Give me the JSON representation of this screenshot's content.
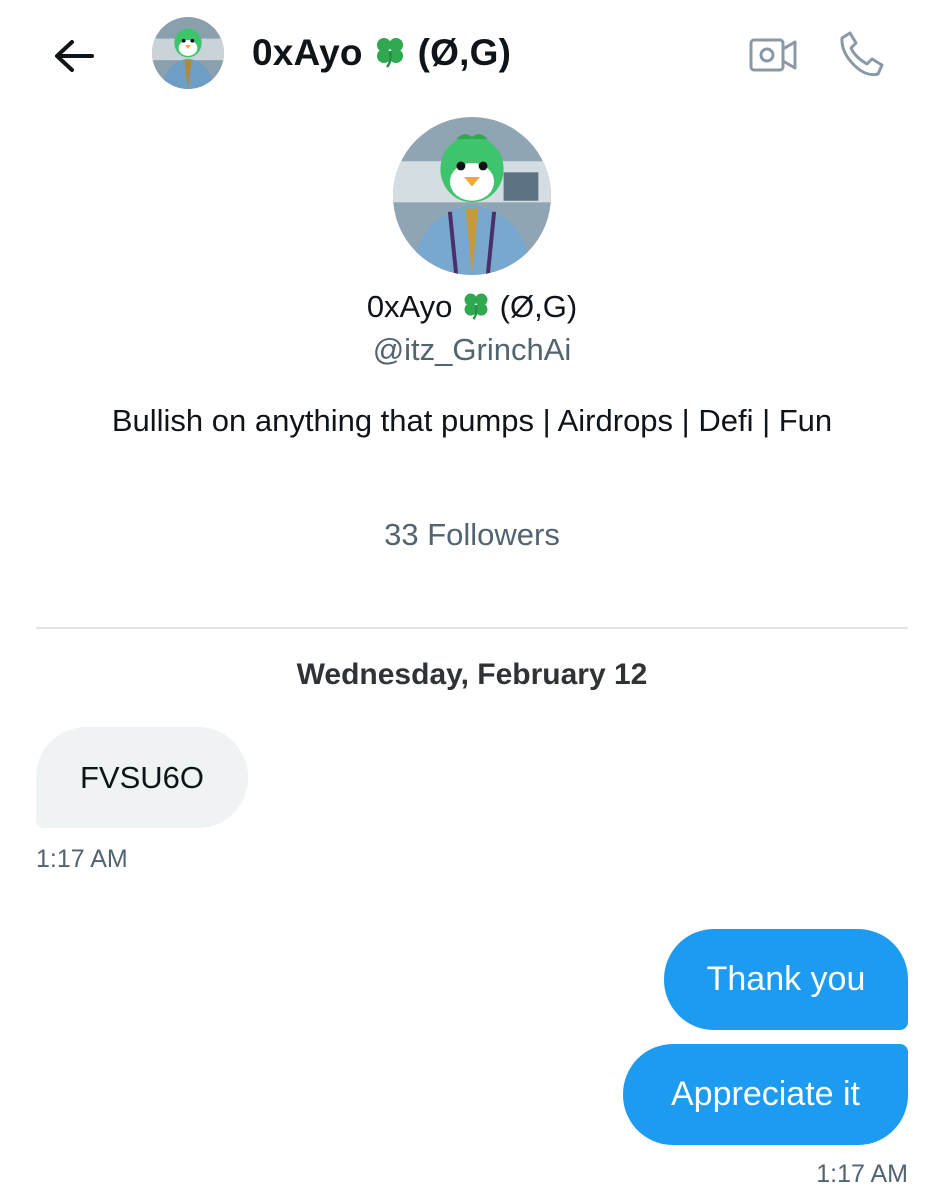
{
  "header": {
    "back_icon": "arrow-left-icon",
    "name": "0xAyo",
    "name_suffix": "(Ø,G)",
    "emoji_icon": "four-leaf-clover-icon",
    "video_icon": "video-camera-icon",
    "phone_icon": "phone-icon"
  },
  "profile": {
    "name": "0xAyo",
    "name_suffix": "(Ø,G)",
    "handle": "@itz_GrinchAi",
    "bio": "Bullish on anything that pumps | Airdrops | Defi | Fun",
    "followers": "33 Followers"
  },
  "conversation": {
    "date": "Wednesday, February 12",
    "messages": [
      {
        "direction": "incoming",
        "text": "FVSU6O",
        "time": "1:17 AM"
      },
      {
        "direction": "outgoing",
        "text": "Thank you"
      },
      {
        "direction": "outgoing",
        "text": "Appreciate it",
        "time": "1:17 AM"
      }
    ]
  },
  "colors": {
    "accent": "#1d9bf0",
    "incoming_bubble": "#eff3f4",
    "secondary_text": "#536471",
    "primary_text": "#0f1419",
    "clover": "#2fa84f"
  }
}
